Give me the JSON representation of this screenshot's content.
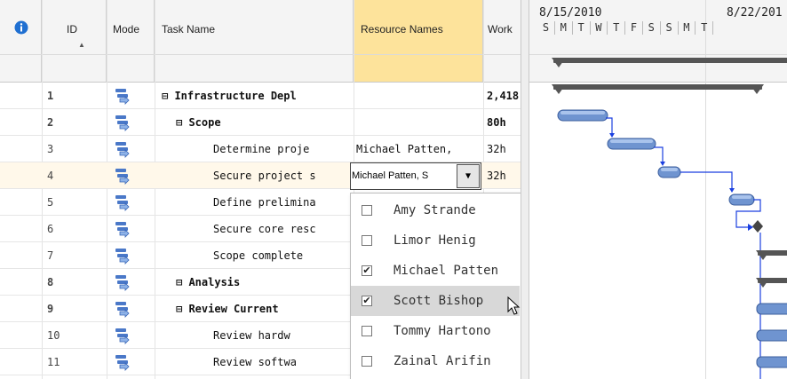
{
  "columns": {
    "info_icon": "info-icon",
    "id": "ID",
    "mode": "Mode",
    "task_name": "Task Name",
    "resource_names": "Resource Names",
    "work": "Work"
  },
  "rows": [
    {
      "id": "1",
      "name": "⊟ Infrastructure Depl",
      "resource": "",
      "work": "2,418",
      "bold": true
    },
    {
      "id": "2",
      "name": "⊟ Scope",
      "resource": "",
      "work": "80h",
      "bold": true
    },
    {
      "id": "3",
      "name": "Determine proje",
      "resource": "Michael Patten,",
      "work": "32h",
      "bold": false
    },
    {
      "id": "4",
      "name": "Secure project s",
      "resource": "",
      "work": "32h",
      "bold": false
    },
    {
      "id": "5",
      "name": "Define prelimina",
      "resource": "",
      "work": "",
      "bold": false
    },
    {
      "id": "6",
      "name": "Secure core resc",
      "resource": "",
      "work": "",
      "bold": false
    },
    {
      "id": "7",
      "name": "Scope complete",
      "resource": "",
      "work": "",
      "bold": false
    },
    {
      "id": "8",
      "name": "⊟ Analysis",
      "resource": "",
      "work": "",
      "bold": true
    },
    {
      "id": "9",
      "name": "⊟ Review Current",
      "resource": "",
      "work": "",
      "bold": true
    },
    {
      "id": "10",
      "name": "Review hardw",
      "resource": "",
      "work": "",
      "bold": false
    },
    {
      "id": "11",
      "name": "Review softwa",
      "resource": "",
      "work": "",
      "bold": false
    }
  ],
  "editor": {
    "value": "Michael Patten, S",
    "button": "▼"
  },
  "dropdown": [
    {
      "label": "Amy Strande",
      "checked": false
    },
    {
      "label": "Limor Henig",
      "checked": false
    },
    {
      "label": "Michael Patten",
      "checked": true
    },
    {
      "label": "Scott Bishop",
      "checked": true
    },
    {
      "label": "Tommy Hartono",
      "checked": false
    },
    {
      "label": "Zainal Arifin",
      "checked": false
    }
  ],
  "gantt": {
    "week1": "8/15/2010",
    "week2": "8/22/201",
    "days1": [
      "S",
      "M",
      "T",
      "W",
      "T",
      "F",
      "S"
    ],
    "days2": [
      "S",
      "M",
      "T"
    ]
  },
  "colors": {
    "accent_header": "#fde39b",
    "bar_blue": "#6f94d0",
    "summary": "#555555",
    "link": "#1a3fe0"
  }
}
